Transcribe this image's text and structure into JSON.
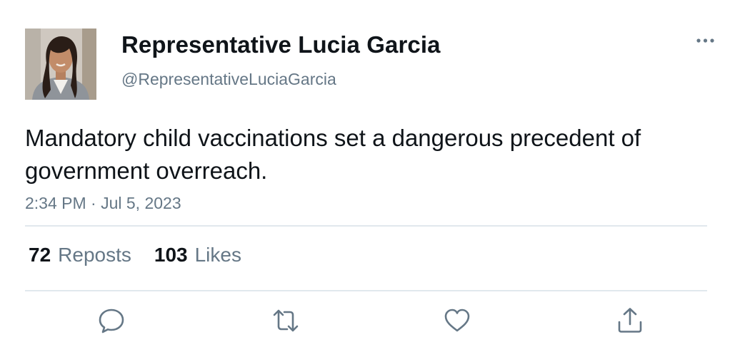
{
  "author": {
    "display_name": "Representative Lucia Garcia",
    "handle": "@RepresentativeLuciaGarcia",
    "avatar": "profile-photo"
  },
  "tweet": {
    "text": "Mandatory child vaccinations set a dangerous precedent of government overreach.",
    "timestamp": "2:34 PM · Jul 5, 2023"
  },
  "stats": {
    "reposts_count": "72",
    "reposts_label": "Reposts",
    "likes_count": "103",
    "likes_label": "Likes"
  },
  "icons": {
    "more": "more-horizontal-icon",
    "reply": "reply-icon",
    "repost": "repost-icon",
    "like": "heart-icon",
    "share": "share-icon"
  },
  "colors": {
    "text_primary": "#0f1419",
    "text_secondary": "#657786",
    "icon": "#657786",
    "divider": "#e1e8ed",
    "background": "#ffffff"
  }
}
